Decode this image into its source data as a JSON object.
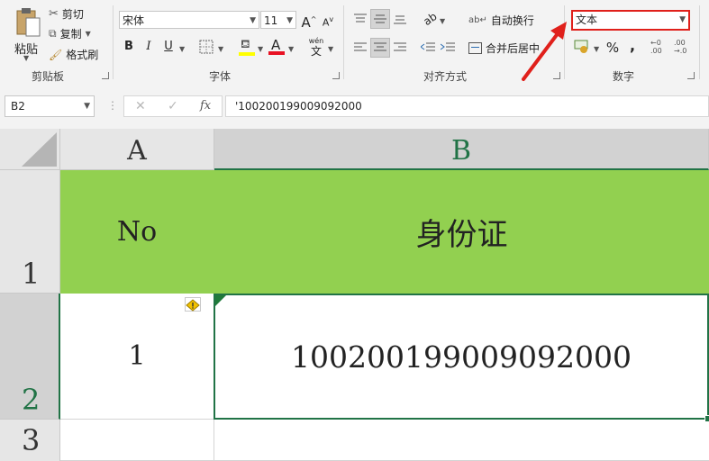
{
  "ribbon": {
    "clipboard": {
      "paste_label": "粘贴",
      "cut_label": "剪切",
      "copy_label": "复制",
      "format_painter_label": "格式刷",
      "group_label": "剪贴板"
    },
    "font": {
      "font_name": "宋体",
      "font_size": "11",
      "bold": "B",
      "italic": "I",
      "underline": "U",
      "grow": "A",
      "shrink": "A",
      "font_color": "A",
      "phonetic_top": "wén",
      "phonetic_bottom": "文",
      "group_label": "字体",
      "font_color_hex": "#e81123",
      "fill_color_hex": "#ffff00"
    },
    "alignment": {
      "wrap_text_label": "自动换行",
      "merge_center_label": "合并后居中",
      "group_label": "对齐方式"
    },
    "number": {
      "format_value": "文本",
      "percent": "%",
      "comma": ",",
      "group_label": "数字"
    }
  },
  "formula_bar": {
    "name_box": "B2",
    "cancel_icon": "✕",
    "enter_icon": "✓",
    "fx_label": "fx",
    "formula": "'100200199009092000"
  },
  "sheet": {
    "columns": [
      "A",
      "B"
    ],
    "rows": [
      "1",
      "2",
      "3"
    ],
    "cells": {
      "A1": "No",
      "B1": "身份证",
      "A2": "1",
      "B2": "100200199009092000"
    },
    "header_fill_hex": "#92d050",
    "selection_color_hex": "#217346"
  }
}
